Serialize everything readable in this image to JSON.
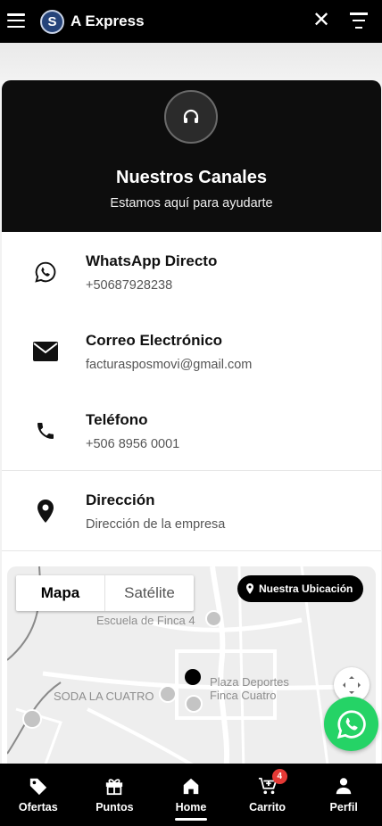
{
  "header": {
    "logo_letter": "S",
    "title": "A Express"
  },
  "channels": {
    "title": "Nuestros Canales",
    "subtitle": "Estamos aquí para ayudarte",
    "items": [
      {
        "label": "WhatsApp Directo",
        "value": "+50687928238",
        "icon": "whatsapp-icon"
      },
      {
        "label": "Correo Electrónico",
        "value": "facturasposmovi@gmail.com",
        "icon": "email-icon"
      },
      {
        "label": "Teléfono",
        "value": "+506 8956 0001",
        "icon": "phone-icon"
      },
      {
        "label": "Dirección",
        "value": "Dirección de la empresa",
        "icon": "location-pin-icon"
      }
    ]
  },
  "map": {
    "tab_map": "Mapa",
    "tab_satellite": "Satélite",
    "location_button": "Nuestra Ubicación",
    "labels": {
      "school": "Escuela de Finca 4",
      "plaza_line1": "Plaza Deportes",
      "plaza_line2": "Finca Cuatro",
      "soda": "SODA LA CUATRO"
    }
  },
  "bottom_nav": {
    "items": [
      {
        "label": "Ofertas",
        "icon": "tag-icon"
      },
      {
        "label": "Puntos",
        "icon": "gift-icon"
      },
      {
        "label": "Home",
        "icon": "home-icon"
      },
      {
        "label": "Carrito",
        "icon": "cart-icon"
      },
      {
        "label": "Perfil",
        "icon": "user-icon"
      }
    ],
    "active": "Home",
    "cart_badge": "4"
  },
  "colors": {
    "header_bg": "#000000",
    "whatsapp_green": "#25d366",
    "badge_red": "#e53935"
  }
}
